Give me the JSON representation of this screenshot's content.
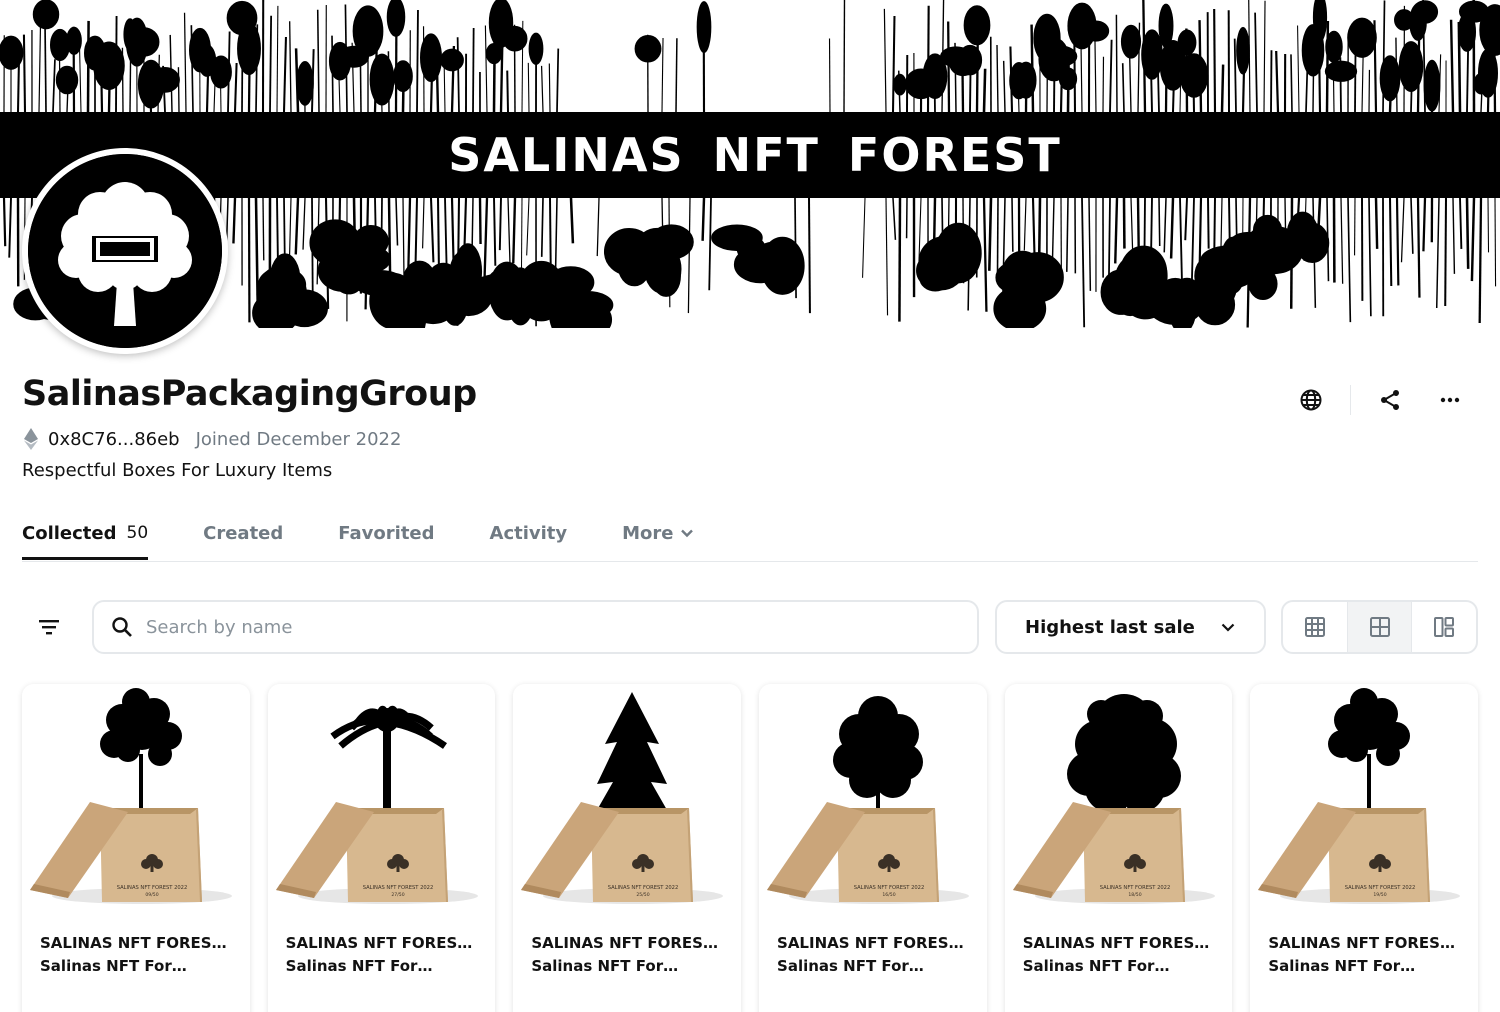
{
  "banner": {
    "title": "SALINAS NFT FOREST"
  },
  "profile": {
    "name": "SalinasPackagingGroup",
    "address": "0x8C76...86eb",
    "joined": "Joined December 2022",
    "bio": "Respectful Boxes For Luxury Items"
  },
  "actions": {
    "icons": [
      "globe-icon",
      "share-icon",
      "more-icon"
    ]
  },
  "tabs": [
    {
      "label": "Collected",
      "count": "50",
      "active": true
    },
    {
      "label": "Created"
    },
    {
      "label": "Favorited"
    },
    {
      "label": "Activity"
    },
    {
      "label": "More"
    }
  ],
  "toolbar": {
    "search_placeholder": "Search by name",
    "sort_label": "Highest last sale",
    "view_modes": [
      "grid-large",
      "grid-small",
      "masonry"
    ],
    "active_view": "grid-small"
  },
  "cards": [
    {
      "title": "SALINAS NFT FOREST 2022",
      "subtitle": "Salinas NFT Forest",
      "box_label": "SALINAS NFT FOREST 2022",
      "edition": "09/50",
      "tree": "pine"
    },
    {
      "title": "SALINAS NFT FOREST 2022",
      "subtitle": "Salinas NFT Forest",
      "box_label": "SALINAS NFT FOREST 2022",
      "edition": "27/50",
      "tree": "palm"
    },
    {
      "title": "SALINAS NFT FOREST 2022",
      "subtitle": "Salinas NFT Forest",
      "box_label": "SALINAS NFT FOREST 2022",
      "edition": "25/50",
      "tree": "fir"
    },
    {
      "title": "SALINAS NFT FOREST 2022",
      "subtitle": "Salinas NFT Forest",
      "box_label": "SALINAS NFT FOREST 2022",
      "edition": "16/50",
      "tree": "birch"
    },
    {
      "title": "SALINAS NFT FOREST 2022",
      "subtitle": "Salinas NFT Forest",
      "box_label": "SALINAS NFT FOREST 2022",
      "edition": "18/50",
      "tree": "oak"
    },
    {
      "title": "SALINAS NFT FOREST 2022",
      "subtitle": "Salinas NFT Forest",
      "box_label": "SALINAS NFT FOREST 2022",
      "edition": "19/50",
      "tree": "pine"
    }
  ],
  "colors": {
    "text": "#121212",
    "muted": "#707a83",
    "border": "#e5e8eb",
    "box": "#d2b48c"
  }
}
